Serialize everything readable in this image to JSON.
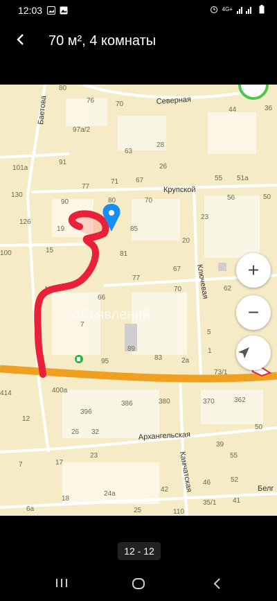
{
  "status_bar": {
    "time": "12:03",
    "network": "4G+",
    "battery": "▮"
  },
  "header": {
    "title": "70 м², 4 комнаты",
    "back_icon": "chevron-left-icon"
  },
  "map": {
    "streets": [
      "Северная",
      "Баетова",
      "Крупской",
      "Ключевая",
      "Архангельская",
      "Камчатская",
      "Белг"
    ],
    "labels": [
      "80",
      "76",
      "70",
      "44",
      "36",
      "97а/2",
      "63",
      "28",
      "91",
      "101а",
      "26",
      "130",
      "77",
      "71",
      "67",
      "55",
      "51а",
      "90",
      "80",
      "70",
      "56",
      "50",
      "126",
      "19",
      "85",
      "23",
      "20",
      "15",
      "100",
      "81",
      "67",
      "77",
      "70",
      "62",
      "105",
      "66",
      "7",
      "5",
      "89",
      "1",
      "83",
      "95",
      "2а",
      "73/1",
      "414",
      "400а",
      "386",
      "380",
      "370",
      "362",
      "12",
      "396",
      "26",
      "32",
      "50",
      "39",
      "7",
      "17",
      "23",
      "55",
      "46",
      "52",
      "18",
      "24а",
      "42",
      "6а",
      "25",
      "110",
      "35/1",
      "41"
    ],
    "watermark": "объявлений",
    "zoom_in": "+",
    "zoom_out": "−"
  },
  "gallery": {
    "page_indicator": "12 - 12"
  },
  "colors": {
    "map_bg": "#f5ebc6",
    "road_main": "#f0a020",
    "road": "#ffffff",
    "pin": "#1a8ef0",
    "annotation": "#e8203a"
  }
}
